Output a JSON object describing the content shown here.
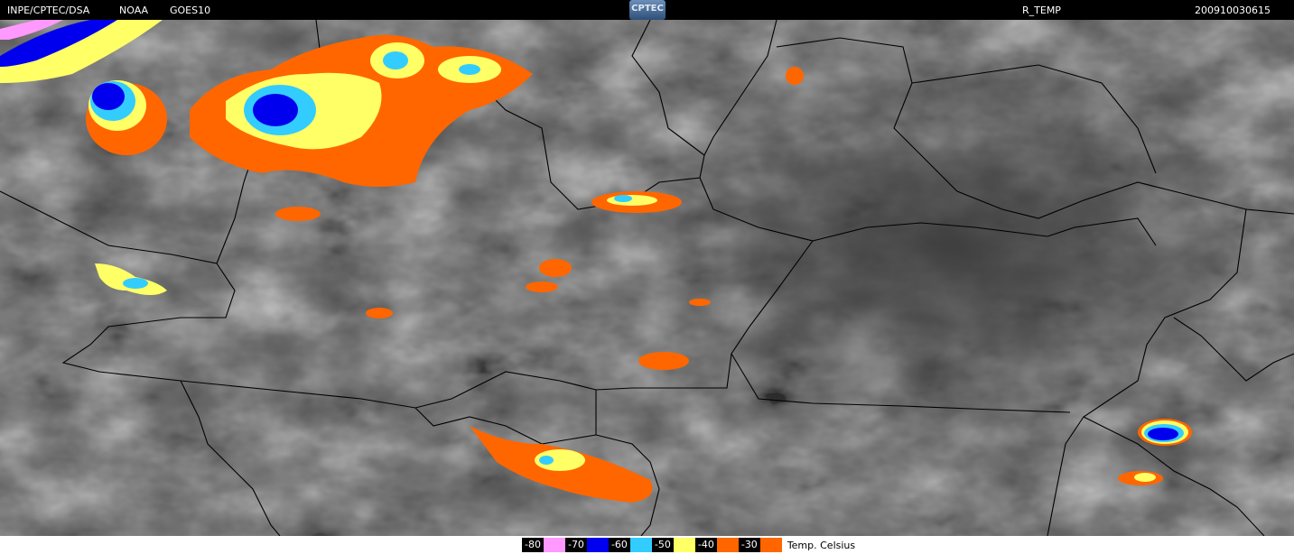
{
  "header": {
    "source": "INPE/CPTEC/DSA",
    "agency": "NOAA",
    "satellite": "GOES10",
    "logo_text": "CPTEC",
    "product": "R_TEMP",
    "timestamp": "200910030615"
  },
  "legend": {
    "unit": "Temp. Celsius",
    "items": [
      {
        "label": "-80",
        "color": "#ff99ff"
      },
      {
        "label": "-70",
        "color": "#0000ee"
      },
      {
        "label": "-60",
        "color": "#33ccff"
      },
      {
        "label": "-50",
        "color": "#ffff66"
      },
      {
        "label": "-40",
        "color": "#ff6600"
      },
      {
        "label": "-30",
        "color": "#ff6600"
      }
    ]
  }
}
